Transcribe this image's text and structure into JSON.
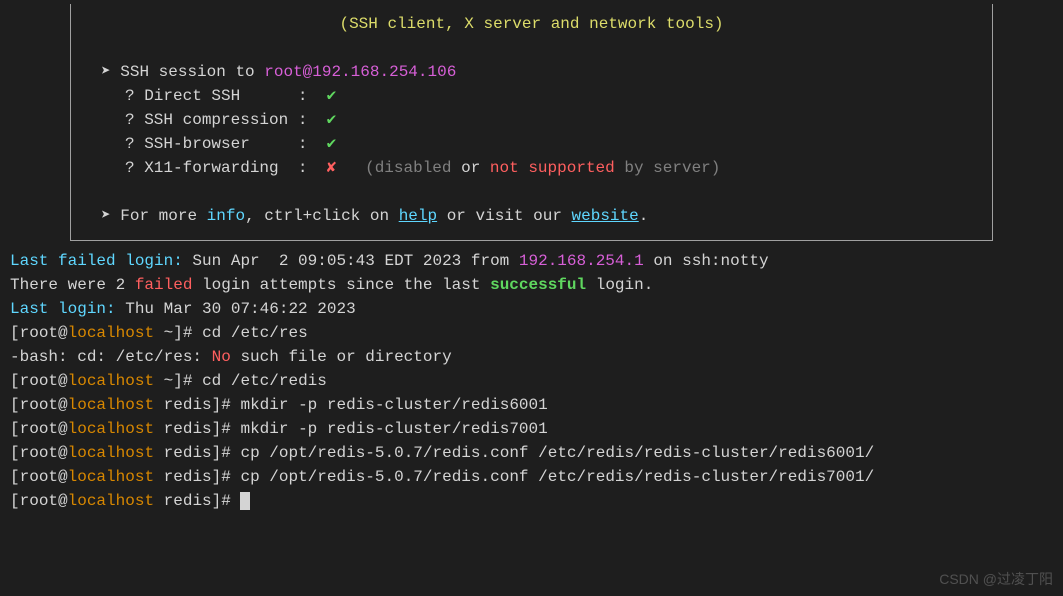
{
  "banner": {
    "subtitle": "(SSH client, X server and network tools)",
    "session_prefix": "SSH session to ",
    "session_target": "root@192.168.254.106",
    "checks": [
      {
        "label": "Direct SSH",
        "pad": "     ",
        "status": "ok"
      },
      {
        "label": "SSH compression",
        "pad": "",
        "status": "ok"
      },
      {
        "label": "SSH-browser",
        "pad": "    ",
        "status": "ok"
      },
      {
        "label": "X11-forwarding",
        "pad": " ",
        "status": "fail",
        "note_a": "(disabled",
        "note_or": " or ",
        "note_b": "not supported",
        "note_c": " by server)"
      }
    ],
    "footer_a": "For more ",
    "footer_info": "info",
    "footer_b": ", ctrl+click on ",
    "footer_help": "help",
    "footer_c": " or visit our ",
    "footer_site": "website",
    "footer_d": "."
  },
  "session": {
    "lf_label": "Last failed login:",
    "lf_time": " Sun Apr  2 09:05:43 EDT 2023 from ",
    "lf_ip": "192.168.254.1",
    "lf_tail": " on ssh:notty",
    "attempts_a": "There were 2 ",
    "attempts_failed": "failed",
    "attempts_b": " login attempts since the last ",
    "attempts_success": "successful",
    "attempts_c": " login.",
    "ll_label": "Last login:",
    "ll_time": " Thu Mar 30 07:46:22 2023"
  },
  "lines": [
    {
      "user": "root",
      "host": "localhost",
      "cwd": "~",
      "cmd": "cd /etc/res"
    },
    {
      "raw_a": "-bash: cd: /etc/res: ",
      "raw_err": "No",
      "raw_b": " such file or directory"
    },
    {
      "user": "root",
      "host": "localhost",
      "cwd": "~",
      "cmd": "cd /etc/redis"
    },
    {
      "user": "root",
      "host": "localhost",
      "cwd": "redis",
      "cmd": "mkdir -p redis-cluster/redis6001"
    },
    {
      "user": "root",
      "host": "localhost",
      "cwd": "redis",
      "cmd": "mkdir -p redis-cluster/redis7001"
    },
    {
      "user": "root",
      "host": "localhost",
      "cwd": "redis",
      "cmd": "cp /opt/redis-5.0.7/redis.conf /etc/redis/redis-cluster/redis6001/"
    },
    {
      "user": "root",
      "host": "localhost",
      "cwd": "redis",
      "cmd": "cp /opt/redis-5.0.7/redis.conf /etc/redis/redis-cluster/redis7001/"
    },
    {
      "user": "root",
      "host": "localhost",
      "cwd": "redis",
      "cmd": "",
      "cursor": true
    }
  ],
  "watermark": "CSDN @过凌丁阳"
}
